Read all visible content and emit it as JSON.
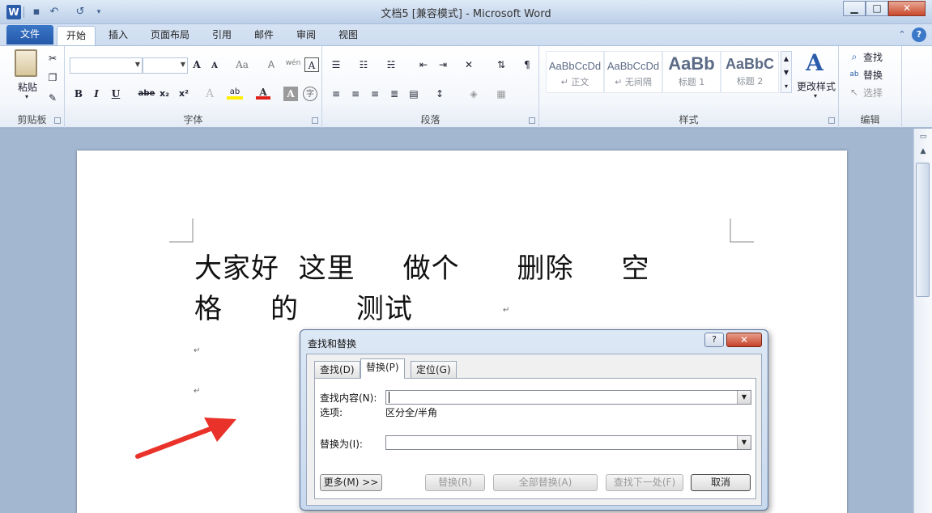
{
  "window": {
    "title": "文档5 [兼容模式] - Microsoft Word",
    "app_icon": "W",
    "minimize": "▁",
    "maximize": "□",
    "close": "✕"
  },
  "ribbon_tabs": [
    "文件",
    "开始",
    "插入",
    "页面布局",
    "引用",
    "邮件",
    "审阅",
    "视图"
  ],
  "ribbon": {
    "clipboard": {
      "paste": "粘贴",
      "label": "剪贴板"
    },
    "font": {
      "label": "字体",
      "grow": "A",
      "shrink": "A",
      "case": "Aa",
      "clear": "A",
      "pinyin": "wén",
      "border_char": "A",
      "bold": "B",
      "italic": "I",
      "underline": "U",
      "strike": "abe",
      "sub": "x₂",
      "sup": "x²",
      "effects": "A",
      "highlight": "ab",
      "color": "A",
      "shade": "A",
      "enclose": "字"
    },
    "paragraph": {
      "label": "段落"
    },
    "styles": {
      "label": "样式",
      "items": [
        {
          "sample": "AaBbCcDd",
          "name": "↵ 正文"
        },
        {
          "sample": "AaBbCcDd",
          "name": "↵ 无间隔"
        },
        {
          "sample": "AaBb",
          "name": "标题 1"
        },
        {
          "sample": "AaBbC",
          "name": "标题 2"
        }
      ],
      "change": "更改样式"
    },
    "editing": {
      "label": "编辑",
      "find": "查找",
      "replace": "替换",
      "select": "选择"
    }
  },
  "document": {
    "line1": "大家好  这里     做个      删除     空",
    "line2": "格     的      测试",
    "pilcrow": "↵"
  },
  "dialog": {
    "title": "查找和替换",
    "help": "?",
    "close": "✕",
    "tabs": [
      "查找(D)",
      "替换(P)",
      "定位(G)"
    ],
    "find_label": "查找内容(N):",
    "find_value": "",
    "options_label": "选项:",
    "options_value": "区分全/半角",
    "replace_label": "替换为(I):",
    "replace_value": "",
    "buttons": {
      "more": "更多(M) >>",
      "replace": "替换(R)",
      "replace_all": "全部替换(A)",
      "find_next": "查找下一处(F)",
      "cancel": "取消"
    }
  },
  "colors": {
    "annotation_arrow": "#e8322a",
    "file_tab": "#2f67b8",
    "dialog_frame": "#c8d9ee"
  }
}
